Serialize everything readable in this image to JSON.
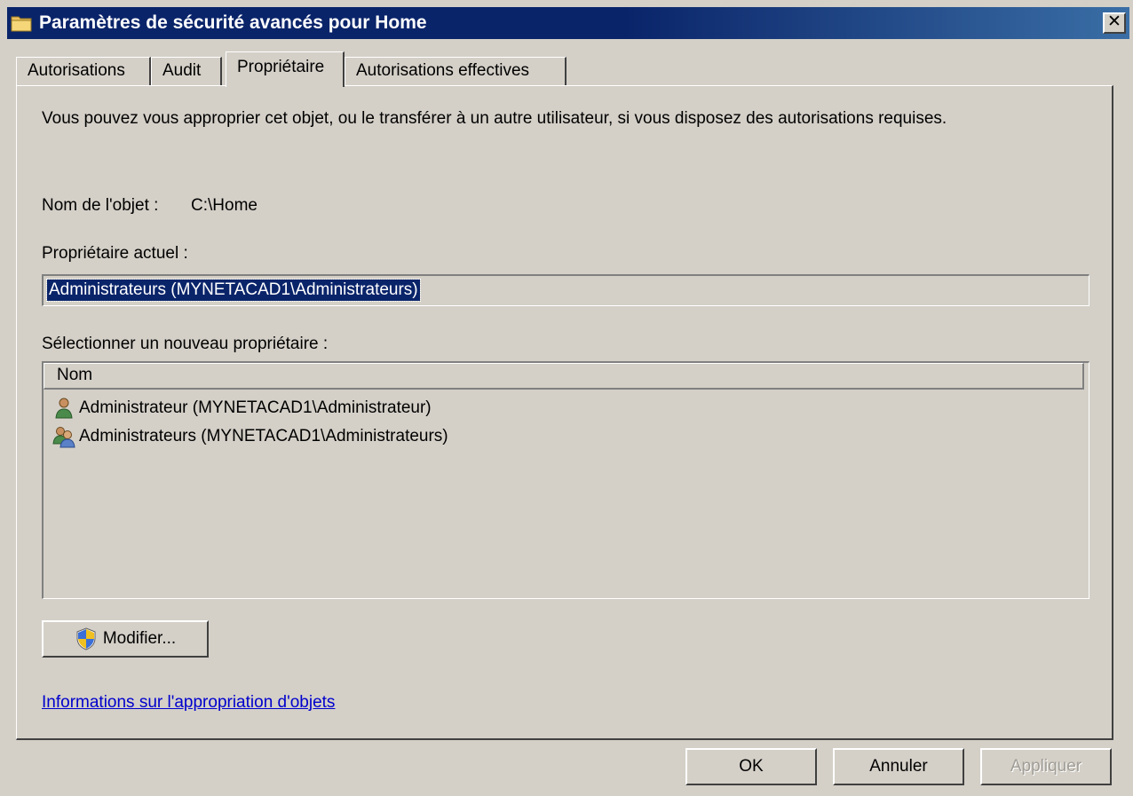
{
  "window": {
    "title": "Paramètres de sécurité avancés pour Home",
    "close_label": "✕"
  },
  "tabs": [
    {
      "label": "Autorisations",
      "active": false
    },
    {
      "label": "Audit",
      "active": false
    },
    {
      "label": "Propriétaire",
      "active": true
    },
    {
      "label": "Autorisations effectives",
      "active": false
    }
  ],
  "owner_tab": {
    "description": "Vous pouvez vous approprier cet objet, ou le transférer à un autre utilisateur, si vous disposez des autorisations requises.",
    "object_name_label": "Nom de l'objet :",
    "object_name_value": "C:\\Home",
    "current_owner_label": "Propriétaire actuel :",
    "current_owner_value": "Administrateurs (MYNETACAD1\\Administrateurs)",
    "select_owner_label": "Sélectionner un nouveau propriétaire :",
    "list_header": "Nom",
    "list_items": [
      {
        "label": "Administrateur (MYNETACAD1\\Administrateur)",
        "icon": "user-icon"
      },
      {
        "label": "Administrateurs (MYNETACAD1\\Administrateurs)",
        "icon": "group-icon"
      }
    ],
    "modify_button": "Modifier...",
    "info_link": "Informations sur l'appropriation d'objets"
  },
  "footer": {
    "ok": "OK",
    "cancel": "Annuler",
    "apply": "Appliquer"
  },
  "colors": {
    "titlebar": "#0a246a",
    "face": "#d4d0c8",
    "selection": "#0a246a",
    "link": "#0000cc"
  }
}
